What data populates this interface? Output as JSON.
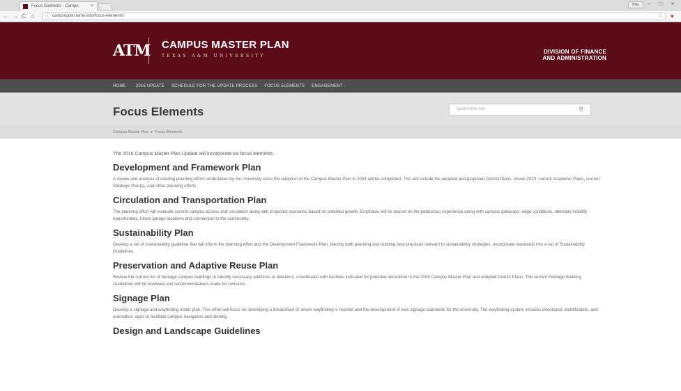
{
  "browser": {
    "tab_title": "Focus Elements - Campu",
    "tab_close": "×",
    "url": "campusplan.tamu.edu/focus-elements/",
    "user_chip": "Bitly",
    "window_controls": "– □ ×",
    "back": "←",
    "forward": "→",
    "reload": "C",
    "home": "⌂",
    "star": "☆",
    "extension": "♥"
  },
  "header": {
    "logo": "ATM",
    "title": "CAMPUS MASTER PLAN",
    "subtitle": "TEXAS A&M UNIVERSITY",
    "division_line1": "DIVISION OF FINANCE",
    "division_line2": "AND ADMINISTRATION",
    "brand_color": "#5b0c16"
  },
  "nav": {
    "items": [
      "HOME ·",
      "2016 UPDATE",
      "SCHEDULE FOR THE UPDATE PROCESS",
      "FOCUS ELEMENTS",
      "ENGAGEMENT ·"
    ]
  },
  "page": {
    "title": "Focus Elements",
    "search_placeholder": "Search this site",
    "search_icon": "⚲"
  },
  "breadcrumb": {
    "home": "Campus Master Plan",
    "separator": "▸",
    "current": "Focus Elements"
  },
  "content": {
    "intro": "The 2016 Campus Master Plan Update will incorporate six focus elements.",
    "sections": [
      {
        "heading": "Development and Framework Plan",
        "body": "A review and analysis of existing planning efforts undertaken by the University since the adoption of the Campus Master Plan in 2004 will be completed. This will include the adopted and proposed District Plans, Vision 2020, current Academic Plans, current Strategic Plan(s), and other planning efforts."
      },
      {
        "heading": "Circulation and Transportation Plan",
        "body": "The planning effort will evaluate current campus access and circulation along with projected scenarios based on potential growth. Emphasis will be placed on the pedestrian experience along with campus gateways, edge conditions, alternate mobility opportunities, future garage locations and connection to the community."
      },
      {
        "heading": "Sustainability Plan",
        "body": "Develop a set of sustainability guideline that will inform the planning effort and the Development Framework Plan. Identify both planning and building best practices relevant to sustainability strategies. Incorporate standards into a set of Sustainability Guidelines."
      },
      {
        "heading": "Preservation and Adaptive Reuse Plan",
        "body": "Review the current list of heritage campus buildings to identify necessary additions or deletions, coordinated with facilities indicated for potential demolition in the 2004 Campus Master Plan and adopted District Plans. The current Heritage Building Guidelines will be reviewed and recommendations made for revisions."
      },
      {
        "heading": "Signage Plan",
        "body": "Develop a signage and wayfinding mater plan. This effort will focus on developing a breakdown of where wayfinding is needed and the development of new signage standards for the university. The wayfinding system includes directional, identification, and orientation signs to facilitate campus navigation and identity."
      },
      {
        "heading": "Design and Landscape Guidelines",
        "body": ""
      }
    ]
  }
}
